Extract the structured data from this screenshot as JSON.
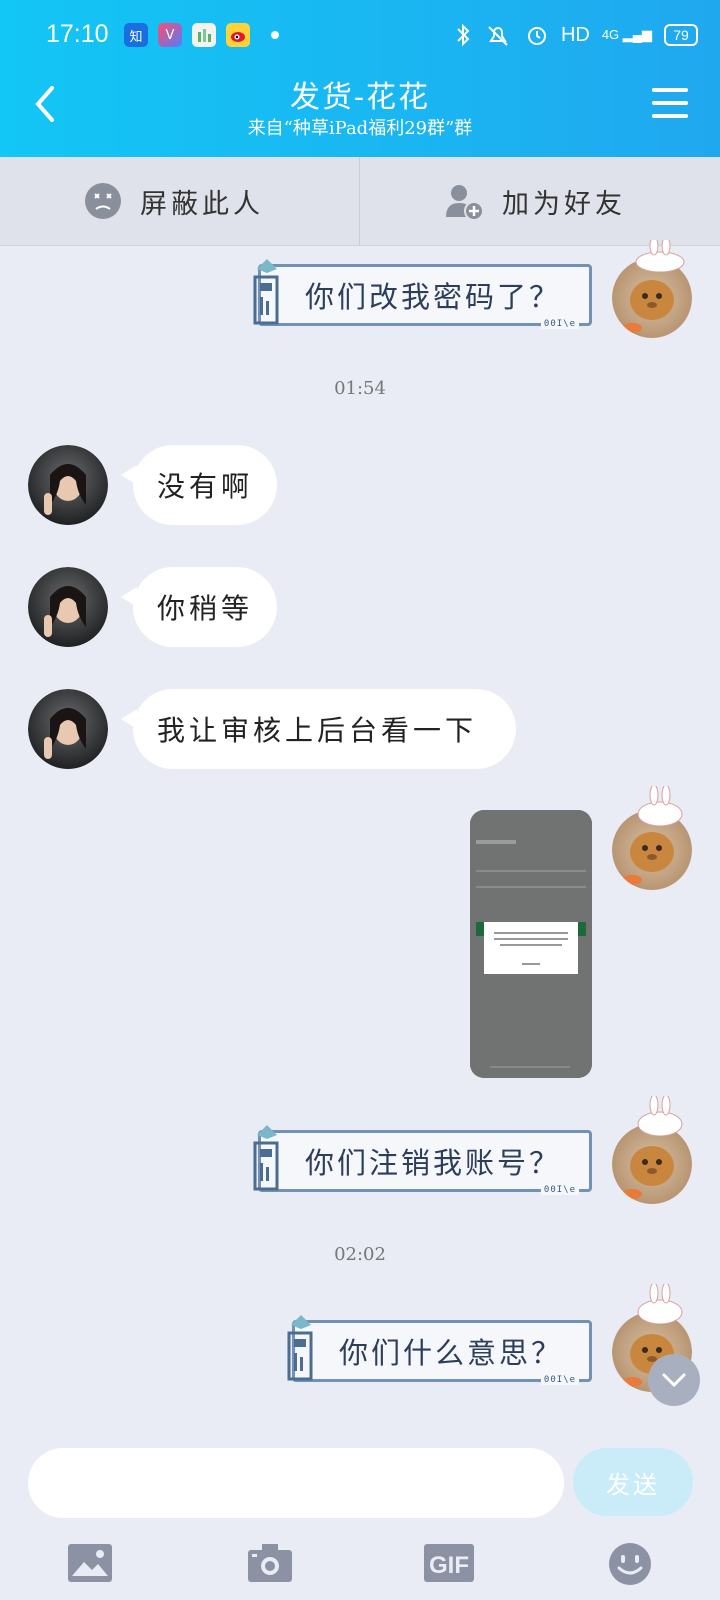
{
  "status_bar": {
    "time": "17:10",
    "app_icons": [
      "知",
      "V",
      "",
      ""
    ],
    "network": "HD",
    "signal": "4G",
    "battery": "79"
  },
  "header": {
    "title": "发货-花花",
    "subtitle": "来自“种草iPad福利29群”群"
  },
  "actions": {
    "block_label": "屏蔽此人",
    "add_friend_label": "加为好友"
  },
  "messages": [
    {
      "side": "right",
      "text": "你们改我密码了？"
    },
    {
      "side": "left",
      "text": "没有啊"
    },
    {
      "side": "left",
      "text": "你稍等"
    },
    {
      "side": "left",
      "text": "我让审核上后台看一下"
    },
    {
      "side": "right",
      "text": "你们注销我账号？"
    },
    {
      "side": "right",
      "text": "你们什么意思？"
    }
  ],
  "timestamps": [
    "01:54",
    "02:02"
  ],
  "bubble_tag": "00I\\e",
  "input": {
    "placeholder": "",
    "send_label": "发送"
  },
  "toolbar": {
    "gif_label": "GIF"
  },
  "colors": {
    "header_start": "#12c6f5",
    "header_end": "#20a8ef",
    "send_button": "#c9ecf8",
    "bubble_border": "#7391b5"
  }
}
